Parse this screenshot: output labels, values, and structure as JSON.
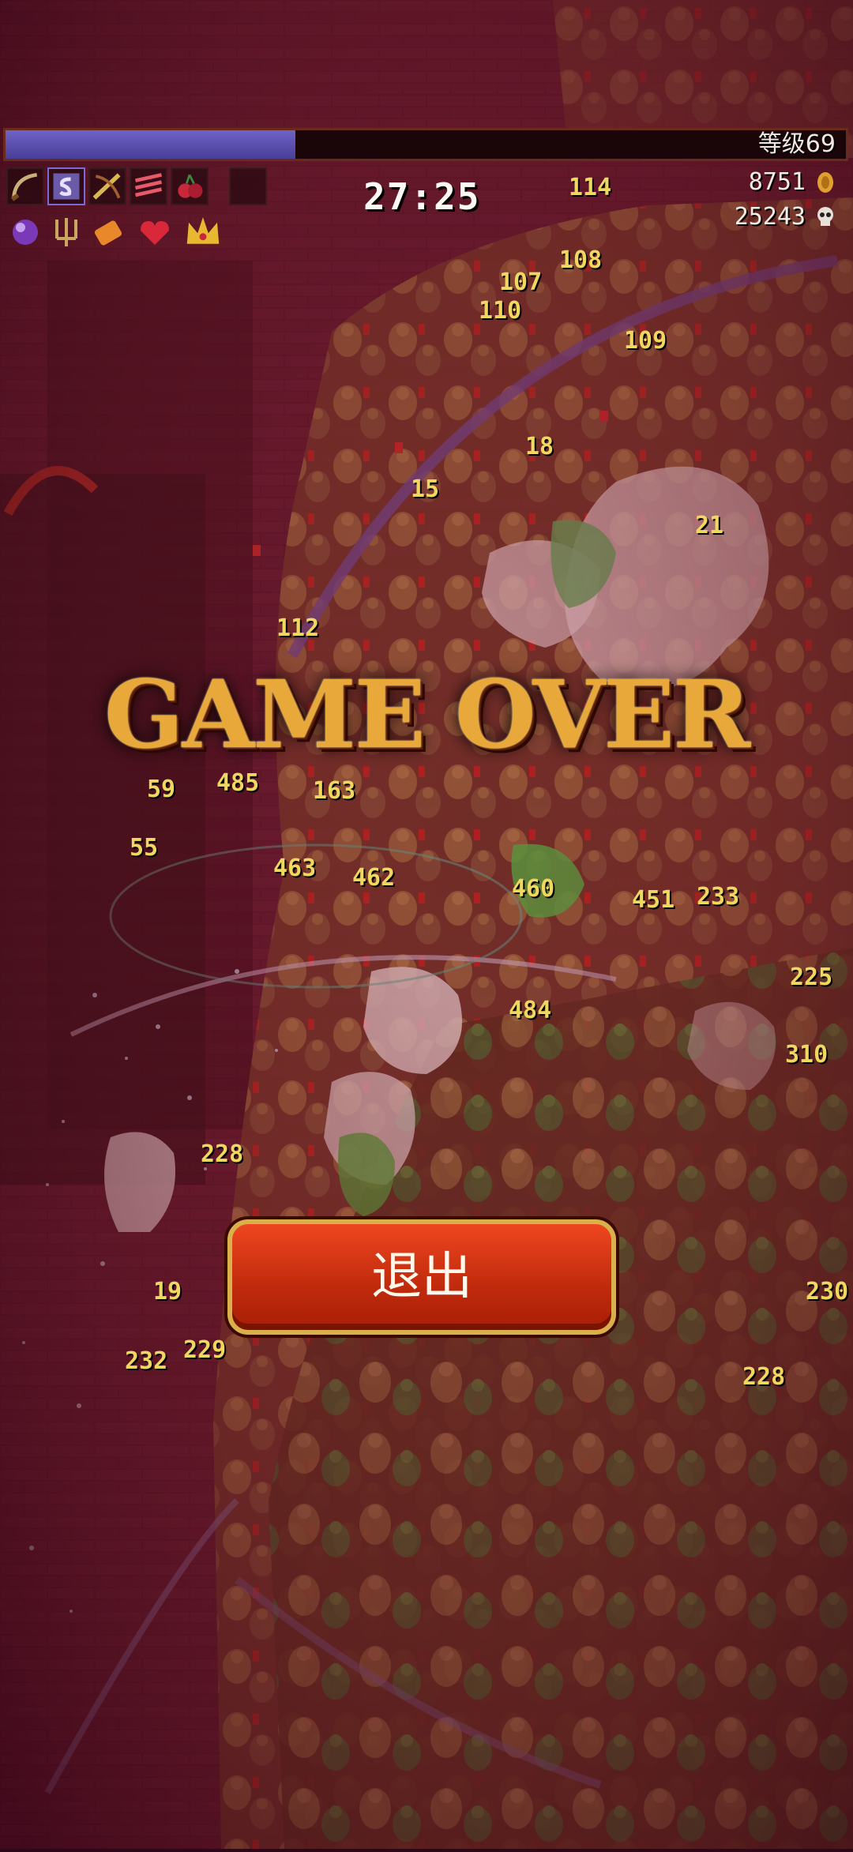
{
  "hud": {
    "level_label": "等级69",
    "xp_progress": 0.345,
    "timer": "27:25",
    "gold": "8751",
    "kills": "25243",
    "weapons": [
      "whip-icon",
      "spellbinder-icon",
      "cross-boomerang-icon",
      "knives-icon",
      "cherry-bomb-icon",
      "empty-slot"
    ],
    "passives": [
      "orb-icon",
      "trident-icon",
      "candle-icon",
      "heart-icon",
      "crown-icon"
    ]
  },
  "game_over_title": "GAME OVER",
  "quit_label": "退出",
  "damage_numbers": [
    "114",
    "108",
    "107",
    "110",
    "109",
    "18",
    "15",
    "21",
    "112",
    "59",
    "485",
    "163",
    "55",
    "463",
    "462",
    "460",
    "451",
    "484",
    "228",
    "229",
    "232",
    "19",
    "310",
    "225",
    "233",
    "230",
    "228"
  ],
  "colors": {
    "accent": "#c82a0c",
    "gold_border": "#d9b04a",
    "xp": "#5f55b6"
  }
}
